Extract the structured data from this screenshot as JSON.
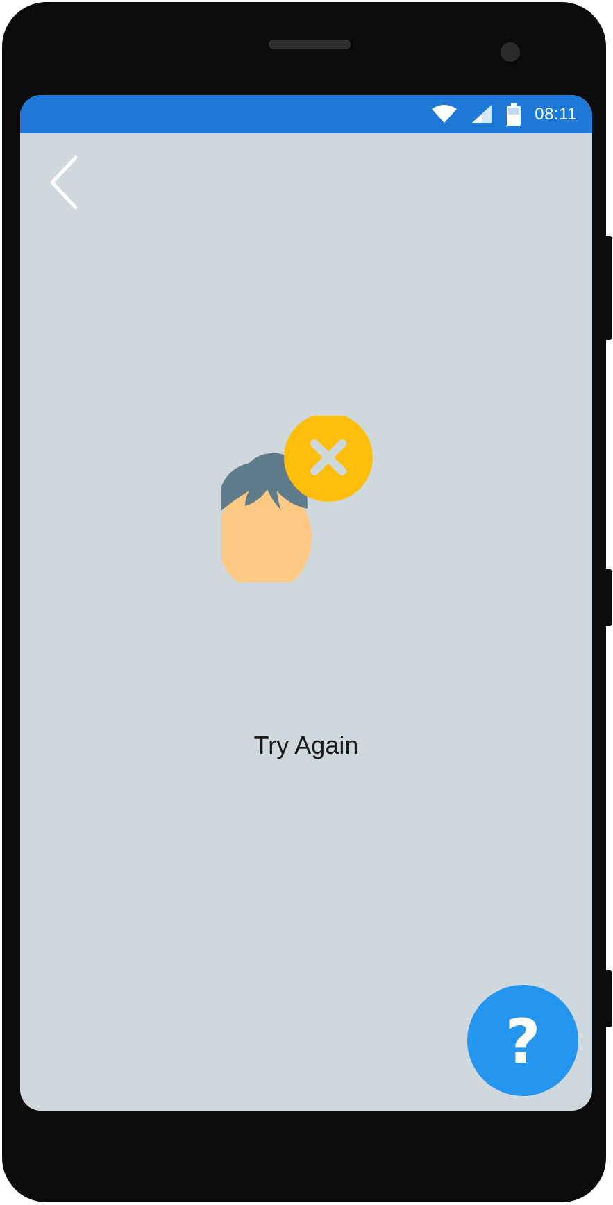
{
  "status_bar": {
    "time": "08:11",
    "icons": [
      "wifi-icon",
      "signal-icon",
      "battery-icon"
    ],
    "color": "#1e78d6"
  },
  "navigation": {
    "back_icon": "chevron-left-icon"
  },
  "illustration": {
    "icon": "face-verification-failed-icon",
    "badge_icon": "close-icon",
    "badge_color": "#ffbe0b"
  },
  "main": {
    "try_again_label": "Try Again"
  },
  "help_button": {
    "icon": "question-mark-icon",
    "glyph": "?",
    "color": "#2496f0"
  },
  "theme": {
    "screen_background": "#cfd8dd"
  }
}
